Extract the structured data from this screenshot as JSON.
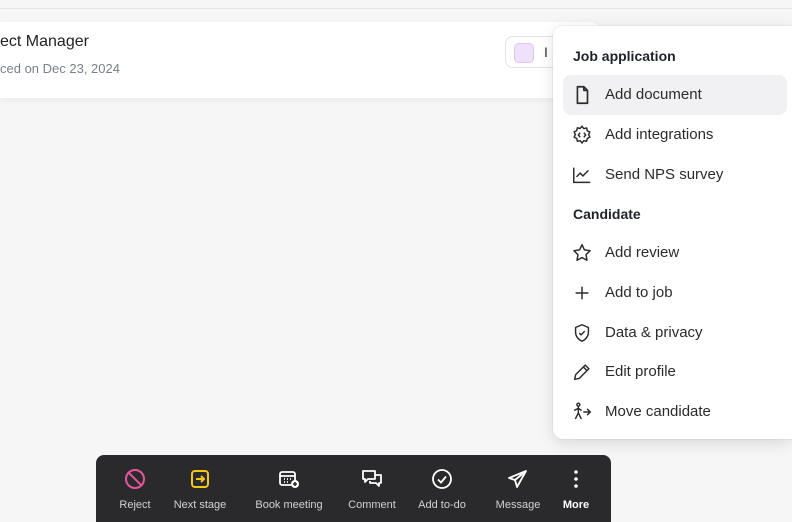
{
  "card": {
    "title": "ect Manager",
    "subtitle": "ced on Dec 23, 2024",
    "stage_pill_text": "I",
    "stage_pill_color": "#efe1fb"
  },
  "menu": {
    "sections": [
      {
        "title": "Job application",
        "items": [
          {
            "label": "Add document",
            "icon": "document-icon",
            "active": true
          },
          {
            "label": "Add integrations",
            "icon": "integrations-icon"
          },
          {
            "label": "Send NPS survey",
            "icon": "chart-line-icon"
          }
        ]
      },
      {
        "title": "Candidate",
        "items": [
          {
            "label": "Add review",
            "icon": "star-icon"
          },
          {
            "label": "Add to job",
            "icon": "plus-icon"
          },
          {
            "label": "Data & privacy",
            "icon": "shield-check-icon"
          },
          {
            "label": "Edit profile",
            "icon": "pencil-icon"
          },
          {
            "label": "Move candidate",
            "icon": "person-walk-arrow-icon"
          }
        ]
      }
    ]
  },
  "toolbar": {
    "actions": [
      {
        "label": "Reject",
        "icon": "ban-icon",
        "color": "#e4569a"
      },
      {
        "label": "Next stage",
        "icon": "arrow-right-box-icon",
        "color": "#f5c518"
      },
      {
        "label": "Book meeting",
        "icon": "calendar-plus-icon",
        "color": "#ffffff"
      },
      {
        "label": "Comment",
        "icon": "chat-bubbles-icon",
        "color": "#ffffff"
      },
      {
        "label": "Add to-do",
        "icon": "check-circle-icon",
        "color": "#ffffff"
      },
      {
        "label": "Message",
        "icon": "paper-plane-icon",
        "color": "#ffffff"
      },
      {
        "label": "More",
        "icon": "more-vertical-icon",
        "color": "#ffffff"
      }
    ]
  }
}
